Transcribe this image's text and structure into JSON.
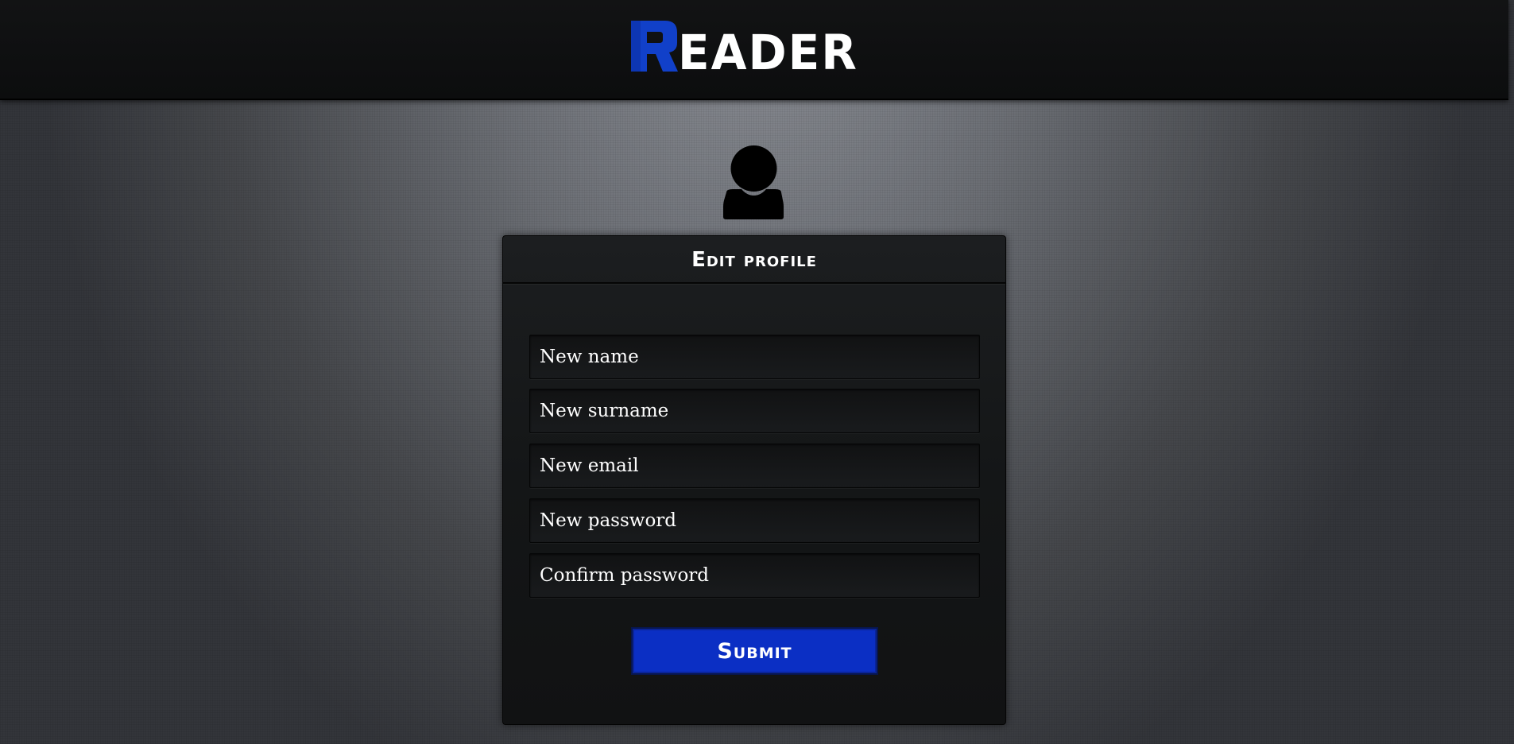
{
  "header": {
    "logo_initial": "R",
    "logo_rest": "EADER",
    "logo_initial_color": "#1140c9",
    "logo_text_color": "#ffffff"
  },
  "avatar": {
    "icon": "user-icon"
  },
  "form": {
    "title": "Edit profile",
    "fields": [
      {
        "name": "name",
        "placeholder": "New name",
        "value": ""
      },
      {
        "name": "surname",
        "placeholder": "New surname",
        "value": ""
      },
      {
        "name": "email",
        "placeholder": "New email",
        "value": ""
      },
      {
        "name": "password",
        "placeholder": "New password",
        "value": ""
      },
      {
        "name": "confirm_password",
        "placeholder": "Confirm password",
        "value": ""
      }
    ],
    "submit_label": "Submit",
    "submit_color": "#0b2fc4"
  }
}
